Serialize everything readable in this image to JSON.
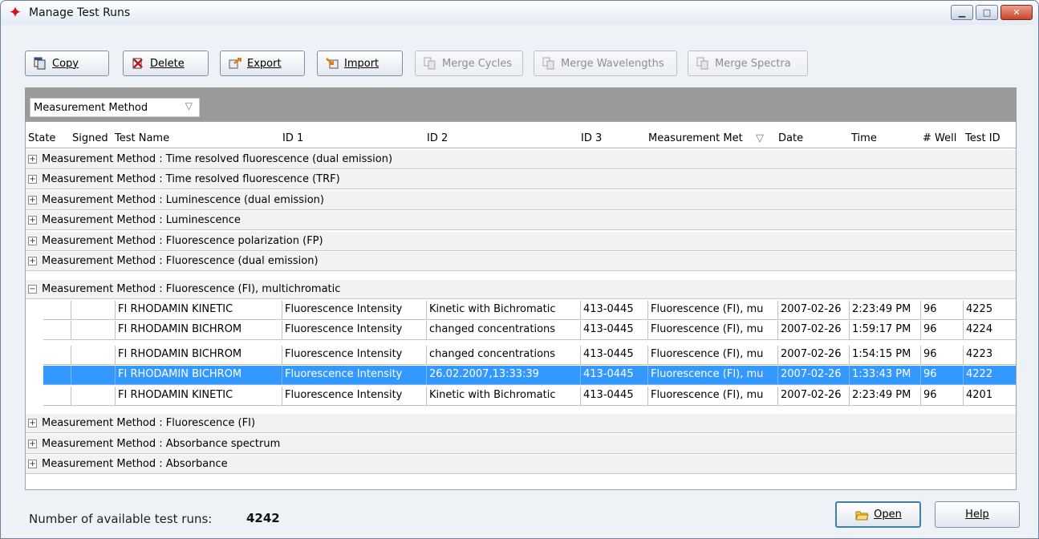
{
  "window": {
    "title": "Manage Test Runs",
    "title_icon": "red-star-icon"
  },
  "toolbar": {
    "buttons": [
      {
        "label": "Copy",
        "icon": "copy-icon",
        "enabled": true
      },
      {
        "label": "Delete",
        "icon": "delete-icon",
        "enabled": true
      },
      {
        "label": "Export",
        "icon": "export-icon",
        "enabled": true
      },
      {
        "label": "Import",
        "icon": "import-icon",
        "enabled": true
      },
      {
        "label": "Merge Cycles",
        "icon": "merge-icon",
        "enabled": false
      },
      {
        "label": "Merge Wavelengths",
        "icon": "merge-icon",
        "enabled": false
      },
      {
        "label": "Merge Spectra",
        "icon": "merge-icon",
        "enabled": false
      }
    ]
  },
  "group_by": {
    "label": "Measurement Method"
  },
  "columns": [
    "State",
    "Signed",
    "Test Name",
    "ID 1",
    "ID 2",
    "ID 3",
    "Measurement Met",
    "Date",
    "Time",
    "# Well",
    "Test ID"
  ],
  "groups_before": [
    "Measurement Method : Time resolved fluorescence (dual emission)",
    "Measurement Method : Time resolved fluorescence (TRF)",
    "Measurement Method : Luminescence (dual emission)",
    "Measurement Method : Luminescence",
    "Measurement Method : Fluorescence polarization (FP)",
    "Measurement Method : Fluorescence (dual emission)"
  ],
  "expanded_group": "Measurement Method : Fluorescence (FI), multichromatic",
  "rows": [
    {
      "name": "FI RHODAMIN KINETIC",
      "id1": "Fluorescence Intensity",
      "id2": "Kinetic with Bichromatic",
      "id3": "413-0445",
      "method": "Fluorescence (FI), mu",
      "date": "2007-02-26",
      "time": "2:23:49 PM",
      "wells": "96",
      "test_id": "4225",
      "selected": false
    },
    {
      "name": "FI RHODAMIN BICHROM",
      "id1": "Fluorescence Intensity",
      "id2": "changed concentrations",
      "id3": "413-0445",
      "method": "Fluorescence (FI), mu",
      "date": "2007-02-26",
      "time": "1:59:17 PM",
      "wells": "96",
      "test_id": "4224",
      "selected": false
    },
    {
      "name": "FI RHODAMIN BICHROM",
      "id1": "Fluorescence Intensity",
      "id2": "changed concentrations",
      "id3": "413-0445",
      "method": "Fluorescence (FI), mu",
      "date": "2007-02-26",
      "time": "1:54:15 PM",
      "wells": "96",
      "test_id": "4223",
      "selected": false
    },
    {
      "name": "FI RHODAMIN BICHROM",
      "id1": "Fluorescence Intensity",
      "id2": "26.02.2007,13:33:39",
      "id3": "413-0445",
      "method": "Fluorescence (FI), mu",
      "date": "2007-02-26",
      "time": "1:33:43 PM",
      "wells": "96",
      "test_id": "4222",
      "selected": true
    },
    {
      "name": "FI RHODAMIN KINETIC",
      "id1": "Fluorescence Intensity",
      "id2": "Kinetic with Bichromatic",
      "id3": "413-0445",
      "method": "Fluorescence (FI), mu",
      "date": "2007-02-26",
      "time": "2:23:49 PM",
      "wells": "96",
      "test_id": "4201",
      "selected": false
    }
  ],
  "groups_after": [
    "Measurement Method : Fluorescence (FI)",
    "Measurement Method : Absorbance spectrum",
    "Measurement Method : Absorbance"
  ],
  "footer": {
    "count_label": "Number of available test runs:",
    "count_value": "4242",
    "open_label": "Open",
    "help_label": "Help"
  },
  "colors": {
    "selection": "#3399ff",
    "group_header_bg": "#9a9a9a",
    "group_row_bg": "#f2f2f2"
  }
}
